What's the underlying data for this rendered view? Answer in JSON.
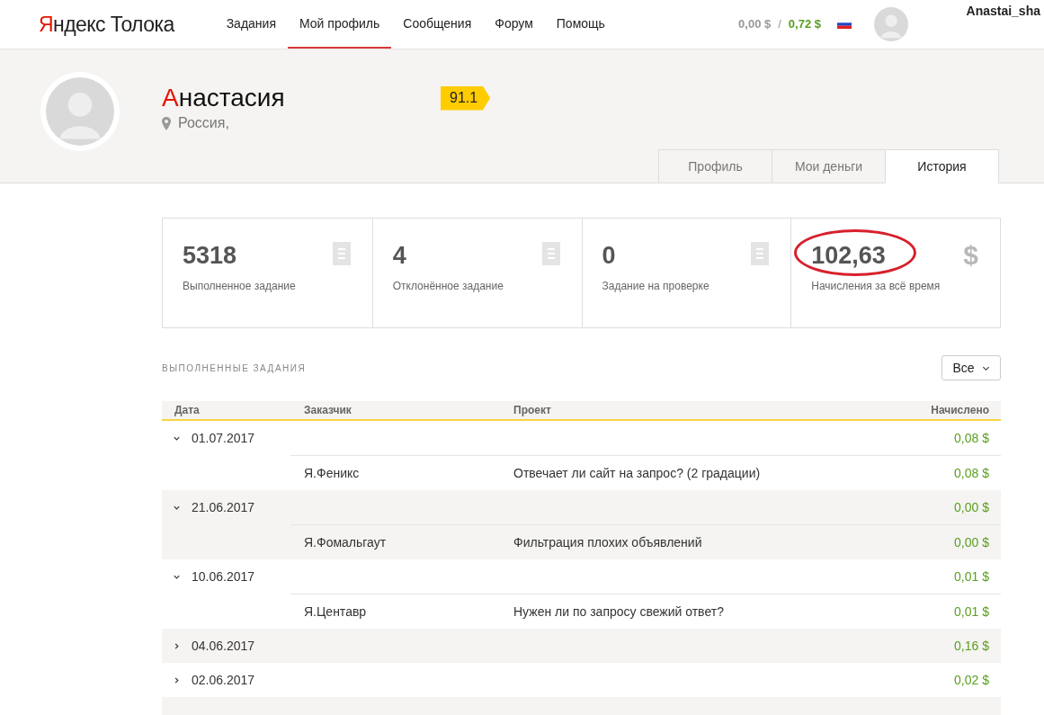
{
  "logo": {
    "accent": "Я",
    "rest": "ндекс Толока"
  },
  "nav": [
    {
      "label": "Задания",
      "selected": false
    },
    {
      "label": "Мой профиль",
      "selected": true
    },
    {
      "label": "Сообщения",
      "selected": false
    },
    {
      "label": "Форум",
      "selected": false
    },
    {
      "label": "Помощь",
      "selected": false
    }
  ],
  "balance": {
    "pending": "0,00 $",
    "separator": "/",
    "available": "0,72 $"
  },
  "user": {
    "name": "Anastai_sha"
  },
  "profile": {
    "name_accent": "А",
    "name_rest": "настасия",
    "location": "Россия,",
    "rating": "91.1"
  },
  "profile_tabs": [
    {
      "label": "Профиль",
      "selected": false
    },
    {
      "label": "Мои деньги",
      "selected": false
    },
    {
      "label": "История",
      "selected": true
    }
  ],
  "stats": [
    {
      "value": "5318",
      "label": "Выполненное задание",
      "kind": "list",
      "circled": false
    },
    {
      "value": "4",
      "label": "Отклонённое задание",
      "kind": "list",
      "circled": false
    },
    {
      "value": "0",
      "label": "Задание на проверке",
      "kind": "list",
      "circled": false
    },
    {
      "value": "102,63",
      "label": "Начисления за всё время",
      "kind": "money",
      "icon_text": "$",
      "circled": true
    }
  ],
  "section_title": "ВЫПОЛНЕННЫЕ ЗАДАНИЯ",
  "filter": {
    "value": "Все"
  },
  "table": {
    "columns": [
      "Дата",
      "Заказчик",
      "Проект",
      "Начислено"
    ],
    "rows": [
      {
        "date": "01.07.2017",
        "amount": "0,08 $",
        "expanded": true,
        "children": [
          {
            "customer": "Я.Феникс",
            "project": "Отвечает ли сайт на запрос? (2 градации)",
            "amount": "0,08 $"
          }
        ]
      },
      {
        "date": "21.06.2017",
        "amount": "0,00 $",
        "expanded": true,
        "children": [
          {
            "customer": "Я.Фомальгаут",
            "project": "Фильтрация плохих объявлений",
            "amount": "0,00 $"
          }
        ]
      },
      {
        "date": "10.06.2017",
        "amount": "0,01 $",
        "expanded": true,
        "children": [
          {
            "customer": "Я.Центавр",
            "project": "Нужен ли по запросу свежий ответ?",
            "amount": "0,01 $"
          }
        ]
      },
      {
        "date": "04.06.2017",
        "amount": "0,16 $",
        "expanded": false
      },
      {
        "date": "02.06.2017",
        "amount": "0,02 $",
        "expanded": false
      }
    ]
  }
}
